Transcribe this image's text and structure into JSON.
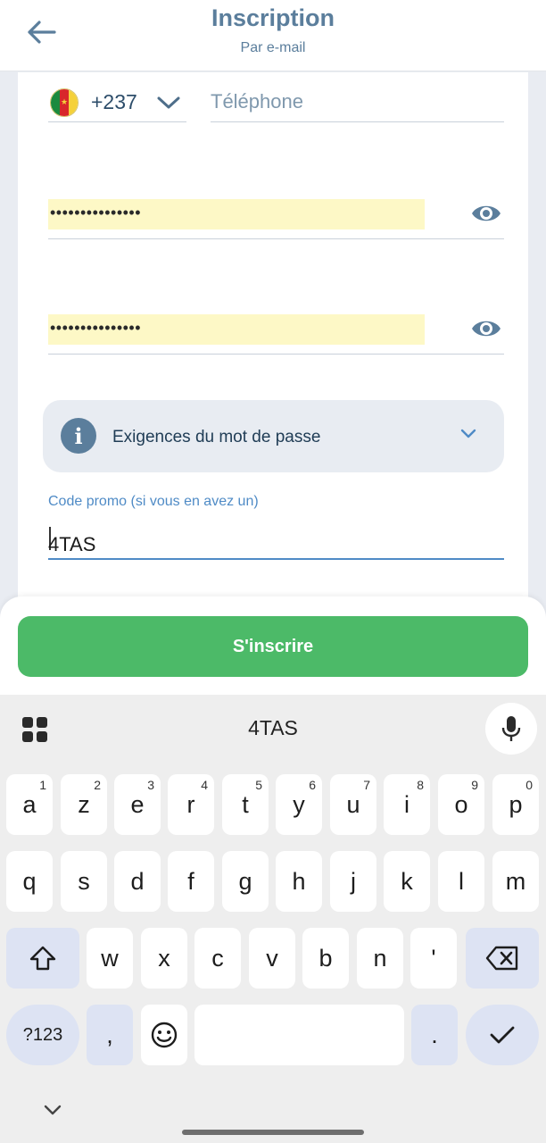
{
  "header": {
    "title": "Inscription",
    "subtitle": "Par e-mail",
    "back_icon": "arrow-left-icon"
  },
  "form": {
    "country_code": "+237",
    "country_flag": "cameroon-flag-icon",
    "phone_placeholder": "Téléphone",
    "password": "•••••••••••••••",
    "password_confirm": "•••••••••••••••",
    "password_requirements_label": "Exigences du mot de passe",
    "promo_label": "Code promo (si vous en avez un)",
    "promo_value": "4TAS"
  },
  "submit_label": "S'inscrire",
  "keyboard": {
    "suggestion": "4TAS",
    "row1": [
      {
        "k": "a",
        "n": "1"
      },
      {
        "k": "z",
        "n": "2"
      },
      {
        "k": "e",
        "n": "3"
      },
      {
        "k": "r",
        "n": "4"
      },
      {
        "k": "t",
        "n": "5"
      },
      {
        "k": "y",
        "n": "6"
      },
      {
        "k": "u",
        "n": "7"
      },
      {
        "k": "i",
        "n": "8"
      },
      {
        "k": "o",
        "n": "9"
      },
      {
        "k": "p",
        "n": "0"
      }
    ],
    "row2": [
      "q",
      "s",
      "d",
      "f",
      "g",
      "h",
      "j",
      "k",
      "l",
      "m"
    ],
    "row3": [
      "w",
      "x",
      "c",
      "v",
      "b",
      "n",
      "'"
    ],
    "numbers_label": "?123",
    "comma_label": ",",
    "period_label": "."
  },
  "colors": {
    "accent": "#5b7e9c",
    "submit": "#4cba68",
    "autofill": "#fdf8c6",
    "focus": "#4f8bc6"
  }
}
